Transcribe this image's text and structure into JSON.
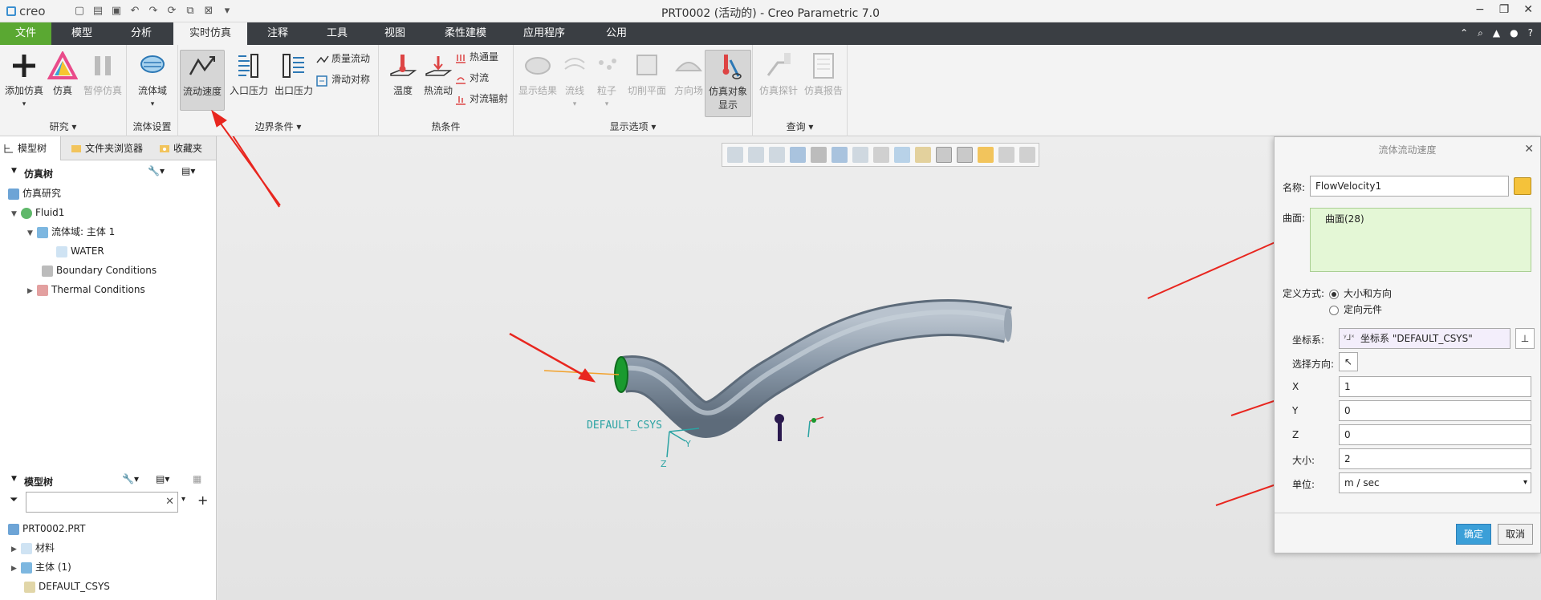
{
  "app": {
    "logo_text": "creo",
    "window_title": "PRT0002 (活动的) - Creo Parametric 7.0"
  },
  "tabs": [
    "文件",
    "模型",
    "分析",
    "实时仿真",
    "注释",
    "工具",
    "视图",
    "柔性建模",
    "应用程序",
    "公用"
  ],
  "ribbon": {
    "groups": {
      "study": "研究",
      "fluid_setup": "流体设置",
      "boundary": "边界条件",
      "thermal": "热条件",
      "display": "显示选项",
      "query": "查询"
    },
    "buttons": {
      "add_sim": "添加仿真",
      "simulate": "仿真",
      "pause_sim": "暂停仿真",
      "fluid_domain": "流体域",
      "flow_velocity": "流动速度",
      "inlet_pressure": "入口压力",
      "outlet_pressure": "出口压力",
      "mass_flow": "质量流动",
      "slip_symmetry": "滑动对称",
      "temperature": "温度",
      "heat_flow": "热流动",
      "heat_flux": "热通量",
      "convection": "对流",
      "convection_radiation": "对流辐射",
      "show_results": "显示结果",
      "streamline": "流线",
      "particle": "粒子",
      "cut_plane": "切削平面",
      "direction_field": "方向场",
      "sim_object_display_1": "仿真对象",
      "sim_object_display_2": "显示",
      "sim_probe": "仿真探针",
      "sim_report": "仿真报告"
    }
  },
  "left_panel": {
    "tabs": [
      "模型树",
      "文件夹浏览器",
      "收藏夹"
    ],
    "sim_tree_title": "仿真树",
    "sim_tree": [
      "仿真研究",
      "Fluid1",
      "流体域: 主体 1",
      "WATER",
      "Boundary Conditions",
      "Thermal Conditions"
    ],
    "model_tree_title": "模型树",
    "filter_placeholder": "",
    "model_tree": [
      "PRT0002.PRT",
      "材料",
      "主体 (1)",
      "DEFAULT_CSYS"
    ]
  },
  "graphics": {
    "csys_label": "DEFAULT_CSYS",
    "axis_y": "Y",
    "axis_z": "Z"
  },
  "dialog": {
    "title": "流体流动速度",
    "name_label": "名称:",
    "name_value": "FlowVelocity1",
    "surface_label": "曲面:",
    "surface_value": "曲面(28)",
    "define_label": "定义方式:",
    "radio_magnitude": "大小和方向",
    "radio_orient": "定向元件",
    "csys_label": "坐标系:",
    "csys_value": "坐标系 \"DEFAULT_CSYS\"",
    "direction_label": "选择方向:",
    "x_label": "X",
    "x_value": "1",
    "y_label": "Y",
    "y_value": "0",
    "z_label": "Z",
    "z_value": "0",
    "size_label": "大小:",
    "size_value": "2",
    "unit_label": "单位:",
    "unit_value": "m / sec",
    "ok": "确定",
    "cancel": "取消"
  },
  "colors": {
    "file_tab": "#5aa832",
    "tabbar": "#3a3e43",
    "accent_blue": "#3b9fd8",
    "annotation_red": "#e8261f",
    "pipe": "#8d9aa8"
  }
}
